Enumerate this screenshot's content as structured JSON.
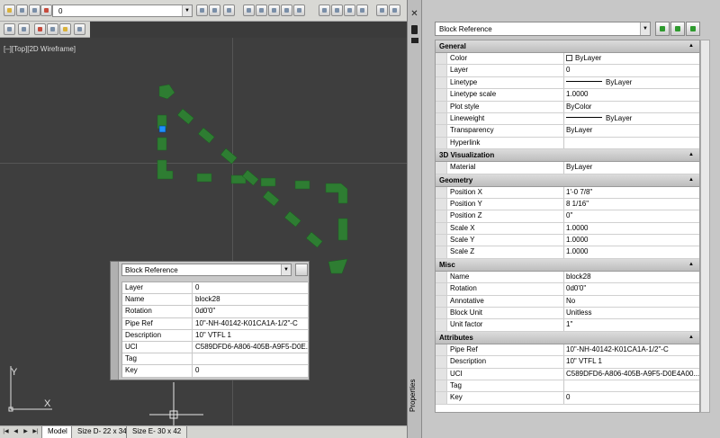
{
  "toolbar": {
    "layer_value": "0"
  },
  "viewport_label": "[–][Top][2D Wireframe]",
  "ucs": {
    "x_label": "X",
    "y_label": "Y"
  },
  "layout_tabs": [
    {
      "label": "Model"
    },
    {
      "label": "Size D- 22 x 34"
    },
    {
      "label": "Size E- 30 x 42"
    }
  ],
  "quick_properties": {
    "object_type": "Block Reference",
    "rows": [
      {
        "key": "Layer",
        "value": "0"
      },
      {
        "key": "Name",
        "value": "block28"
      },
      {
        "key": "Rotation",
        "value": "0d0'0\""
      },
      {
        "key": "Pipe Ref",
        "value": "10\"-NH-40142-K01CA1A-1/2\"-C"
      },
      {
        "key": "Description",
        "value": "10\" VTFL 1"
      },
      {
        "key": "UCI",
        "value": "C589DFD6-A806-405B-A9F5-D0E..."
      },
      {
        "key": "Tag",
        "value": ""
      },
      {
        "key": "Key",
        "value": "0"
      }
    ]
  },
  "properties": {
    "panel_label": "Properties",
    "object_type": "Block Reference",
    "categories": [
      {
        "name": "General",
        "rows": [
          {
            "key": "Color",
            "value": "ByLayer",
            "kind": "swatch"
          },
          {
            "key": "Layer",
            "value": "0"
          },
          {
            "key": "Linetype",
            "value": "ByLayer",
            "kind": "line"
          },
          {
            "key": "Linetype scale",
            "value": "1.0000"
          },
          {
            "key": "Plot style",
            "value": "ByColor"
          },
          {
            "key": "Lineweight",
            "value": "ByLayer",
            "kind": "line"
          },
          {
            "key": "Transparency",
            "value": "ByLayer"
          },
          {
            "key": "Hyperlink",
            "value": ""
          }
        ]
      },
      {
        "name": "3D Visualization",
        "rows": [
          {
            "key": "Material",
            "value": "ByLayer"
          }
        ]
      },
      {
        "name": "Geometry",
        "rows": [
          {
            "key": "Position X",
            "value": "1'-0 7/8\""
          },
          {
            "key": "Position Y",
            "value": "8 1/16\""
          },
          {
            "key": "Position Z",
            "value": "0\""
          },
          {
            "key": "Scale X",
            "value": "1.0000"
          },
          {
            "key": "Scale Y",
            "value": "1.0000"
          },
          {
            "key": "Scale Z",
            "value": "1.0000"
          }
        ]
      },
      {
        "name": "Misc",
        "rows": [
          {
            "key": "Name",
            "value": "block28"
          },
          {
            "key": "Rotation",
            "value": "0d0'0\""
          },
          {
            "key": "Annotative",
            "value": "No"
          },
          {
            "key": "Block Unit",
            "value": "Unitless"
          },
          {
            "key": "Unit factor",
            "value": "1\""
          }
        ]
      },
      {
        "name": "Attributes",
        "rows": [
          {
            "key": "Pipe Ref",
            "value": "10\"-NH-40142-K01CA1A-1/2\"-C"
          },
          {
            "key": "Description",
            "value": "10\" VTFL 1"
          },
          {
            "key": "UCI",
            "value": "C589DFD6-A806-405B-A9F5-D0E4A00..."
          },
          {
            "key": "Tag",
            "value": ""
          },
          {
            "key": "Key",
            "value": "0"
          }
        ]
      }
    ]
  },
  "colors": {
    "drawing_background": "#3e3e3e",
    "selected_object": "#2e7d32",
    "grip": "#1e90ff"
  }
}
